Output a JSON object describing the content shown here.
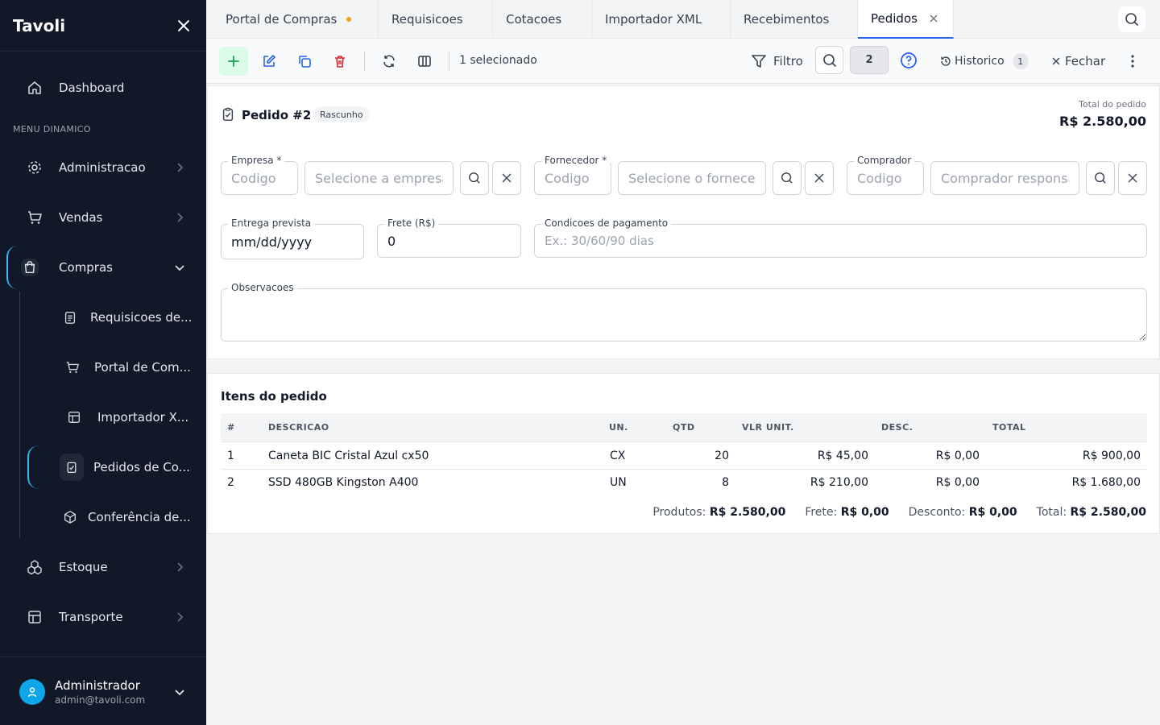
{
  "sidebar": {
    "brand": "Tavoli",
    "section_label": "MENU DINAMICO",
    "items": {
      "dashboard": "Dashboard",
      "administracao": "Administracao",
      "vendas": "Vendas",
      "compras": "Compras",
      "estoque": "Estoque",
      "transporte": "Transporte"
    },
    "compras_sub": {
      "requisicoes": "Requisicoes de...",
      "portal": "Portal de Com...",
      "importador": "Importador X...",
      "pedidos": "Pedidos de Co...",
      "conferencia": "Conferência de..."
    },
    "user": {
      "name": "Administrador",
      "email": "admin@tavoli.com"
    }
  },
  "tabs": [
    {
      "label": "Portal de Compras"
    },
    {
      "label": "Requisicoes"
    },
    {
      "label": "Cotacoes"
    },
    {
      "label": "Importador XML"
    },
    {
      "label": "Recebimentos"
    },
    {
      "label": "Pedidos"
    }
  ],
  "toolbar": {
    "selected_text": "1 selecionado",
    "filter_label": "Filtro",
    "page_number": "2",
    "history_label": "Historico",
    "history_count": "1",
    "close_label": "Fechar"
  },
  "order": {
    "title": "Pedido #2",
    "status": "Rascunho",
    "total_label": "Total do pedido",
    "total_value": "R$ 2.580,00"
  },
  "form": {
    "empresa": {
      "label": "Empresa *",
      "code_placeholder": "Codigo",
      "name_placeholder": "Selecione a empresa"
    },
    "fornecedor": {
      "label": "Fornecedor *",
      "code_placeholder": "Codigo",
      "name_placeholder": "Selecione o fornecedor"
    },
    "comprador": {
      "label": "Comprador",
      "code_placeholder": "Codigo",
      "name_placeholder": "Comprador responsavel"
    },
    "entrega": {
      "label": "Entrega prevista",
      "value": "mm/dd/yyyy"
    },
    "frete": {
      "label": "Frete (R$)",
      "value": "0"
    },
    "condicoes": {
      "label": "Condicoes de pagamento",
      "placeholder": "Ex.: 30/60/90 dias"
    },
    "observacoes": {
      "label": "Observacoes",
      "value": ""
    }
  },
  "items": {
    "title": "Itens do pedido",
    "columns": [
      "#",
      "DESCRICAO",
      "UN.",
      "QTD",
      "VLR UNIT.",
      "DESC.",
      "TOTAL"
    ],
    "rows": [
      [
        "1",
        "Caneta BIC Cristal Azul cx50",
        "CX",
        "20",
        "R$ 45,00",
        "R$ 0,00",
        "R$ 900,00"
      ],
      [
        "2",
        "SSD 480GB Kingston A400",
        "UN",
        "8",
        "R$ 210,00",
        "R$ 0,00",
        "R$ 1.680,00"
      ]
    ],
    "summary": {
      "produtos_label": "Produtos:",
      "produtos_value": "R$ 2.580,00",
      "frete_label": "Frete:",
      "frete_value": "R$ 0,00",
      "desconto_label": "Desconto:",
      "desconto_value": "R$ 0,00",
      "total_label": "Total:",
      "total_value": "R$ 2.580,00"
    }
  },
  "colors": {
    "sidebar_bg": "#111827",
    "accent": "#38bdf8",
    "primary": "#2563eb",
    "success": "#16a34a",
    "danger": "#dc2626"
  }
}
